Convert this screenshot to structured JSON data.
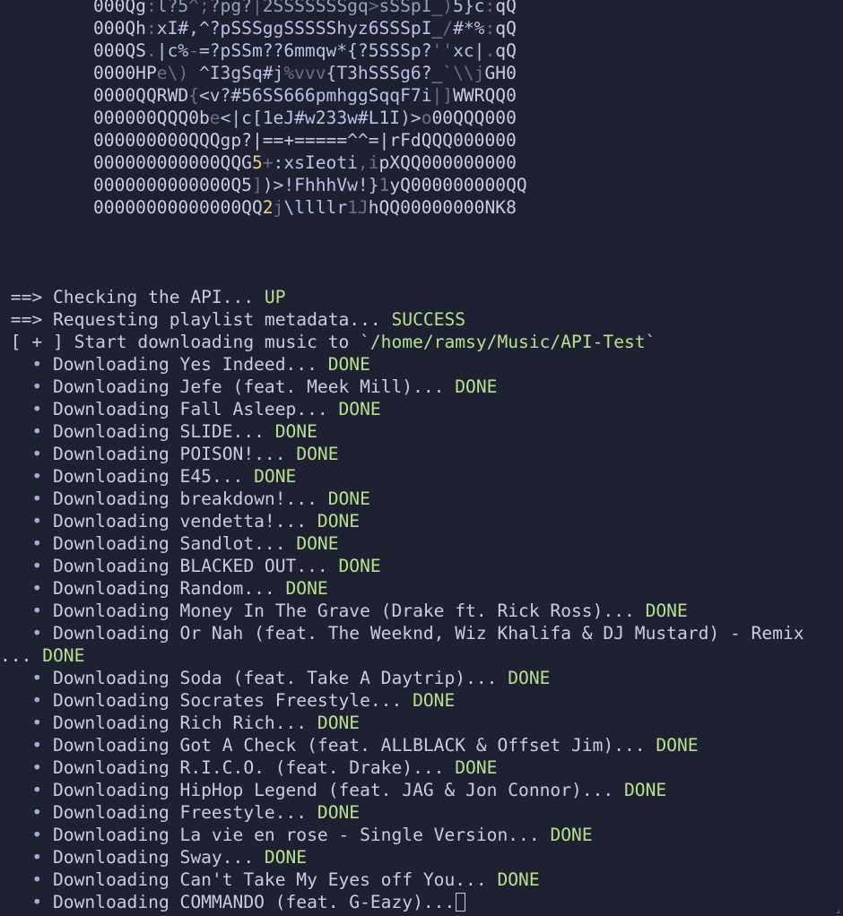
{
  "ascii_art": [
    [
      {
        "t": "000Qg",
        "c": ""
      },
      {
        "t": ":",
        "c": "dim"
      },
      {
        "t": "l?5",
        "c": "mid"
      },
      {
        "t": "^;",
        "c": "dim"
      },
      {
        "t": "?pg?",
        "c": "mid"
      },
      {
        "t": "|",
        "c": "dim"
      },
      {
        "t": "2SSSSSSSgq",
        "c": "mid"
      },
      {
        "t": ">",
        "c": "dim"
      },
      {
        "t": "sSSpI_",
        "c": "mid"
      },
      {
        "t": ")",
        "c": "dim"
      },
      {
        "t": "5}c",
        "c": "pale"
      },
      {
        "t": ":",
        "c": "dim"
      },
      {
        "t": "qQ",
        "c": ""
      }
    ],
    [
      {
        "t": "000Qh",
        "c": ""
      },
      {
        "t": ":",
        "c": "dim"
      },
      {
        "t": "xI#,^?pSSSggSSSSShyz6SSSpI_",
        "c": "pale"
      },
      {
        "t": "/",
        "c": "dim"
      },
      {
        "t": "#*%",
        "c": "pale"
      },
      {
        "t": ":",
        "c": "dim"
      },
      {
        "t": "qQ",
        "c": ""
      }
    ],
    [
      {
        "t": "000QS",
        "c": ""
      },
      {
        "t": ".",
        "c": "dim"
      },
      {
        "t": "|c%",
        "c": "pale"
      },
      {
        "t": "-",
        "c": "dim"
      },
      {
        "t": "=?pSSm??6mmqw*{?5SSSp?",
        "c": "pale"
      },
      {
        "t": "''",
        "c": "dim"
      },
      {
        "t": "xc|",
        "c": "pale"
      },
      {
        "t": ".",
        "c": "dim"
      },
      {
        "t": "qQ",
        "c": ""
      }
    ],
    [
      {
        "t": "0000HP",
        "c": ""
      },
      {
        "t": "e\\)",
        "c": "dim"
      },
      {
        "t": " ^I3gSq#j",
        "c": "pale"
      },
      {
        "t": "%vvv",
        "c": "dim"
      },
      {
        "t": "{T3hSSSg6?_",
        "c": "pale"
      },
      {
        "t": "`\\\\j",
        "c": "dim"
      },
      {
        "t": "GH0",
        "c": ""
      }
    ],
    [
      {
        "t": "0000QQRWD",
        "c": ""
      },
      {
        "t": "{",
        "c": "dim"
      },
      {
        "t": "<v?#56SS666pmhggSqqF7i",
        "c": "pale"
      },
      {
        "t": "|]",
        "c": "dim"
      },
      {
        "t": "WWRQQ0",
        "c": ""
      }
    ],
    [
      {
        "t": "000000QQQ0b",
        "c": ""
      },
      {
        "t": "e",
        "c": "dim"
      },
      {
        "t": "<|c[1eJ#w233w#L1I)>",
        "c": "pale"
      },
      {
        "t": "o",
        "c": "dim"
      },
      {
        "t": "00QQQ000",
        "c": ""
      }
    ],
    [
      {
        "t": "000000000QQQgp?|==+=====^^=|rFdQQQ000000",
        "c": ""
      }
    ],
    [
      {
        "t": "000000000000QQG",
        "c": ""
      },
      {
        "t": "5",
        "c": "warm"
      },
      {
        "t": "+",
        "c": "dim"
      },
      {
        "t": ":xsIeoti",
        "c": "pale"
      },
      {
        "t": ",i",
        "c": "dim"
      },
      {
        "t": "pXQQ000000000",
        "c": ""
      }
    ],
    [
      {
        "t": "0000000000000Q5",
        "c": ""
      },
      {
        "t": "]",
        "c": "dim"
      },
      {
        "t": ")>!FhhhVw!}",
        "c": "pale"
      },
      {
        "t": "1",
        "c": "dim"
      },
      {
        "t": "yQ000000000QQ",
        "c": ""
      }
    ],
    [
      {
        "t": "00000000000000QQ",
        "c": ""
      },
      {
        "t": "2",
        "c": "warm"
      },
      {
        "t": "j",
        "c": "dim"
      },
      {
        "t": "\\llllr",
        "c": "pale"
      },
      {
        "t": "1J",
        "c": "dim"
      },
      {
        "t": "hQQ00000000NK8",
        "c": ""
      }
    ]
  ],
  "log": {
    "api_check": {
      "prefix": " ==> ",
      "text": "Checking the API... ",
      "status": "UP"
    },
    "metadata": {
      "prefix": " ==> ",
      "text": "Requesting playlist metadata... ",
      "status": "SUCCESS"
    },
    "start": {
      "prefix": " [ + ] ",
      "text": "Start downloading music to `",
      "path": "/home/ramsy/Music/API-Test",
      "suffix": "`"
    },
    "bullet": "   • ",
    "download_prefix": "Downloading ",
    "done_label": "DONE",
    "downloads": [
      {
        "title": "Yes Indeed",
        "status": "DONE"
      },
      {
        "title": "Jefe (feat. Meek Mill)",
        "status": "DONE"
      },
      {
        "title": "Fall Asleep",
        "status": "DONE"
      },
      {
        "title": "SLIDE",
        "status": "DONE"
      },
      {
        "title": "POISON!",
        "status": "DONE"
      },
      {
        "title": "E45",
        "status": "DONE"
      },
      {
        "title": "breakdown!",
        "status": "DONE"
      },
      {
        "title": "vendetta!",
        "status": "DONE"
      },
      {
        "title": "Sandlot",
        "status": "DONE"
      },
      {
        "title": "BLACKED OUT",
        "status": "DONE"
      },
      {
        "title": "Random",
        "status": "DONE"
      },
      {
        "title": "Money In The Grave (Drake ft. Rick Ross)",
        "status": "DONE"
      },
      {
        "title": "Or Nah (feat. The Weeknd, Wiz Khalifa & DJ Mustard) - Remix",
        "status": "DONE",
        "wrap_at": 59
      },
      {
        "title": "Soda (feat. Take A Daytrip)",
        "status": "DONE"
      },
      {
        "title": "Socrates Freestyle",
        "status": "DONE"
      },
      {
        "title": "Rich Rich",
        "status": "DONE"
      },
      {
        "title": "Got A Check (feat. ALLBLACK & Offset Jim)",
        "status": "DONE"
      },
      {
        "title": "R.I.C.O. (feat. Drake)",
        "status": "DONE"
      },
      {
        "title": "HipHop Legend (feat. JAG & Jon Connor)",
        "status": "DONE"
      },
      {
        "title": "Freestyle",
        "status": "DONE"
      },
      {
        "title": "La vie en rose - Single Version",
        "status": "DONE"
      },
      {
        "title": "Sway",
        "status": "DONE"
      },
      {
        "title": "Can't Take My Eyes off You",
        "status": "DONE"
      },
      {
        "title": "COMMANDO (feat. G-Eazy)",
        "status": ""
      }
    ]
  },
  "colors": {
    "background": "#1e2132",
    "foreground": "#c8cde0",
    "success": "#b7e08f",
    "bullet": "#9fb0e0"
  }
}
